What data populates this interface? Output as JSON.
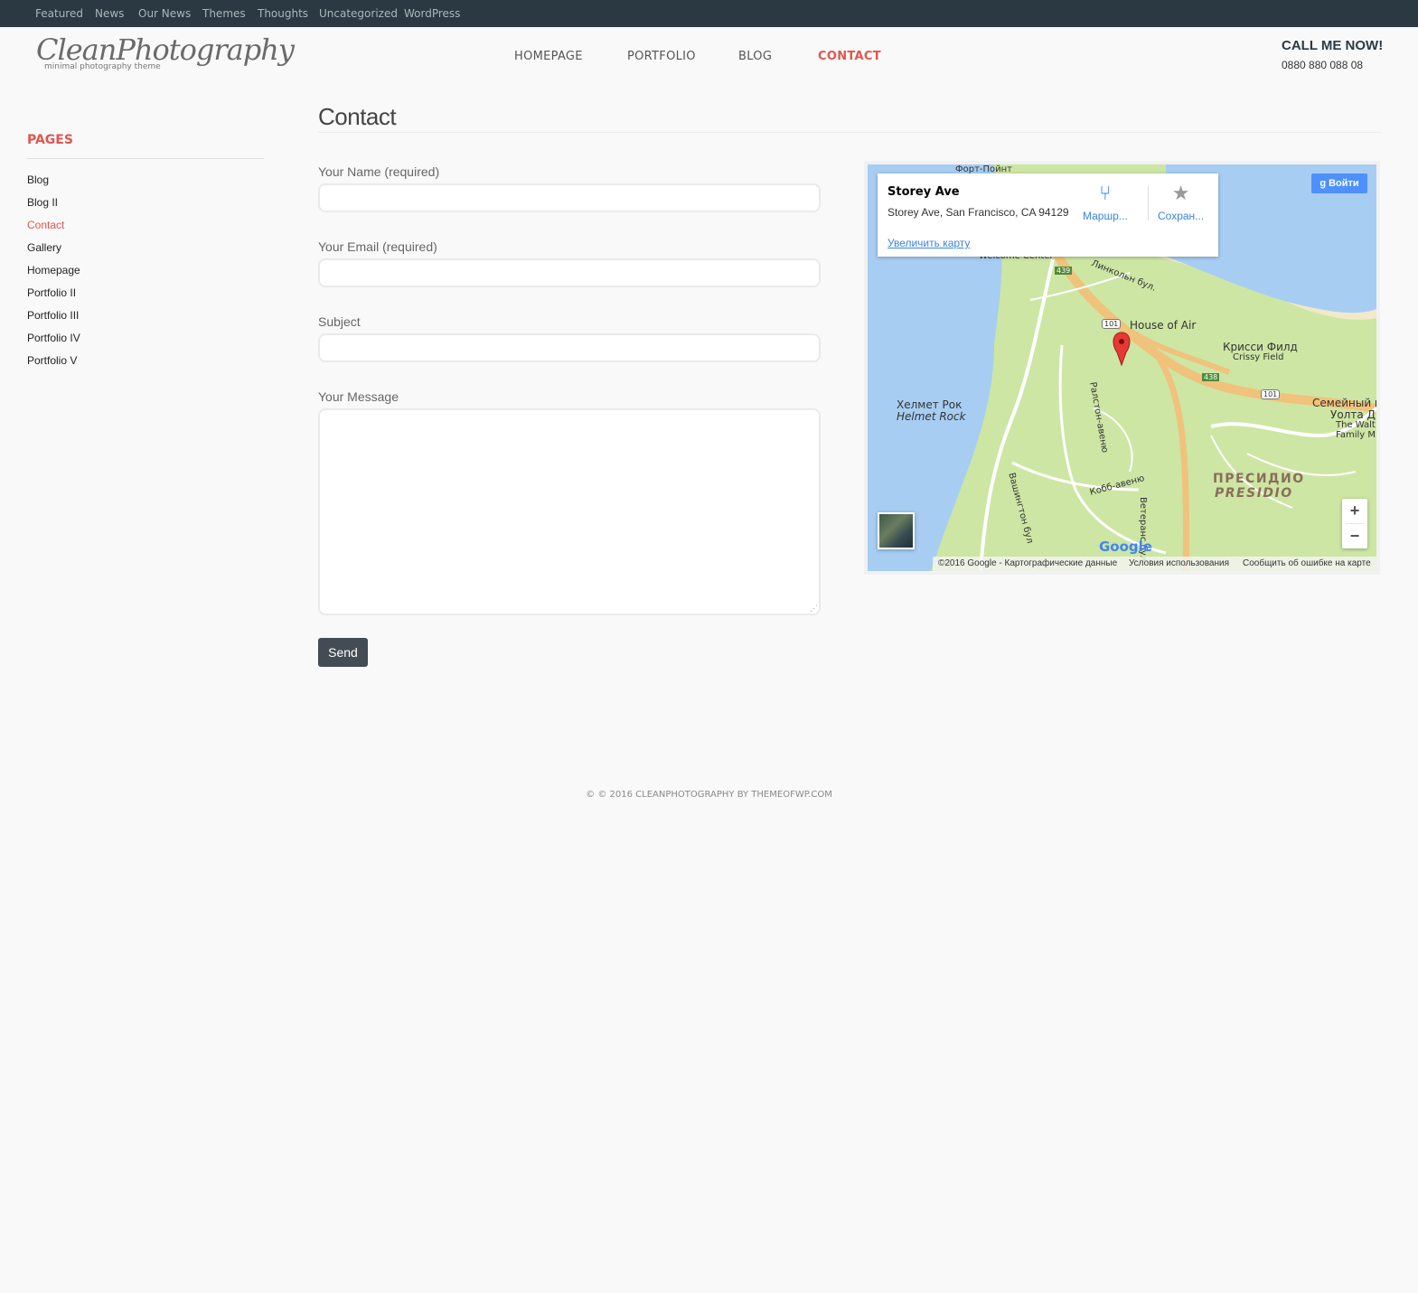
{
  "topbar": {
    "items": [
      "Featured",
      "News",
      "Our News",
      "Themes",
      "Thoughts",
      "Uncategorized",
      "WordPress"
    ]
  },
  "header": {
    "logo": "CleanPhotography",
    "tagline": "minimal photography theme",
    "nav": [
      {
        "label": "HOMEPAGE",
        "active": false
      },
      {
        "label": "PORTFOLIO",
        "active": false
      },
      {
        "label": "BLOG",
        "active": false
      },
      {
        "label": "CONTACT",
        "active": true
      }
    ],
    "callme": "CALL ME NOW!",
    "phone": "0880 880 088 08"
  },
  "sidebar": {
    "title": "PAGES",
    "items": [
      {
        "label": "Blog",
        "active": false
      },
      {
        "label": "Blog II",
        "active": false
      },
      {
        "label": "Contact",
        "active": true
      },
      {
        "label": "Gallery",
        "active": false
      },
      {
        "label": "Homepage",
        "active": false
      },
      {
        "label": "Portfolio II",
        "active": false
      },
      {
        "label": "Portfolio III",
        "active": false
      },
      {
        "label": "Portfolio IV",
        "active": false
      },
      {
        "label": "Portfolio V",
        "active": false
      }
    ]
  },
  "main": {
    "title": "Contact",
    "form": {
      "name_label": "Your Name (required)",
      "name_value": "",
      "email_label": "Your Email (required)",
      "email_value": "",
      "subject_label": "Subject",
      "subject_value": "",
      "message_label": "Your Message",
      "message_value": "",
      "send_label": "Send"
    }
  },
  "map": {
    "place_name": "Storey Ave",
    "address": "Storey Ave, San Francisco, CA 94129",
    "enlarge_link": "Увеличить карту",
    "directions_label": "Маршр...",
    "save_label": "Сохран...",
    "signin_label": "Войти",
    "zoom_in": "+",
    "zoom_out": "−",
    "google": "Google",
    "footer": {
      "copyright": "©2016 Google - Картографические данные",
      "terms": "Условия использования",
      "report": "Сообщить об ошибке на карте"
    },
    "labels": {
      "fort_point": "Форт-Пойнт",
      "welcome_center": "Welcome Center",
      "lincoln_blvd": "Линкольн бул.",
      "house_of_air": "House of Air",
      "crissy_ru": "Крисси Филд",
      "crissy_en": "Crissy Field",
      "helmet_ru": "Хелмет Рок",
      "helmet_en": "Helmet Rock",
      "family_ru": "Семейный м",
      "family_ru2": "Уолта Д",
      "family_en": "The Walt",
      "family_en2": "Family M",
      "presidio_ru": "ПРЕСИДИО",
      "presidio_en": "PRESIDIO",
      "veterans": "Ветеранс бул.",
      "ralston": "Ралстон-авеню",
      "cobb": "Кобб-авеню",
      "washington": "Вашингтон бул",
      "r439": "439",
      "r101a": "101",
      "r438": "438",
      "r101b": "101"
    }
  },
  "footer": {
    "text": "© © 2016 CLEANPHOTOGRAPHY BY THEMEOFWP.COM"
  },
  "colors": {
    "accent": "#e0564e",
    "topbar": "#2b3a42",
    "button": "#434c54",
    "link": "#3a84df"
  }
}
